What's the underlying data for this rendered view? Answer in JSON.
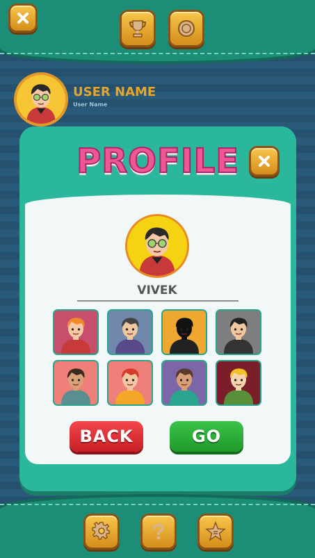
{
  "header": {
    "close_icon": "close-icon",
    "trophy_icon": "trophy-icon",
    "coin_icon": "coin-icon"
  },
  "user": {
    "name": "USER NAME",
    "subtitle": "User Name"
  },
  "profile": {
    "title": "PROFILE",
    "player_name": "VIVEK",
    "avatars": [
      {
        "bg": "#c84f6c",
        "hair": "#f28a2a",
        "skin": "#f5c9a5",
        "shirt": "#c83a3a"
      },
      {
        "bg": "#6f88ac",
        "hair": "#444444",
        "skin": "#f0c7a0",
        "shirt": "#5b4a8a"
      },
      {
        "bg": "#f0a730",
        "hair": "#111111",
        "skin": "#111111",
        "shirt": "#222222"
      },
      {
        "bg": "#7e7e7e",
        "hair": "#222222",
        "skin": "#f0c7a0",
        "shirt": "#333333"
      },
      {
        "bg": "#ee8079",
        "hair": "#3a2a20",
        "skin": "#d9a078",
        "shirt": "#5a8f8f"
      },
      {
        "bg": "#ee7f7a",
        "hair": "#d63b2a",
        "skin": "#f3c5a1",
        "shirt": "#f2a62a"
      },
      {
        "bg": "#7c66a8",
        "hair": "#5a3a2a",
        "skin": "#d9a078",
        "shirt": "#2aa58d"
      },
      {
        "bg": "#7c1d2a",
        "hair": "#f2c12a",
        "skin": "#f5d4b0",
        "shirt": "#5a8f3a"
      }
    ],
    "back_label": "BACK",
    "go_label": "GO"
  },
  "footer": {
    "settings_icon": "gear-icon",
    "help_icon": "question-icon",
    "rate_icon": "star-icon"
  },
  "colors": {
    "accent": "#2bb79c",
    "title_pink": "#ee5892",
    "gold": "#f7c64b",
    "back_red": "#e12c32",
    "go_green": "#2fb03c"
  }
}
